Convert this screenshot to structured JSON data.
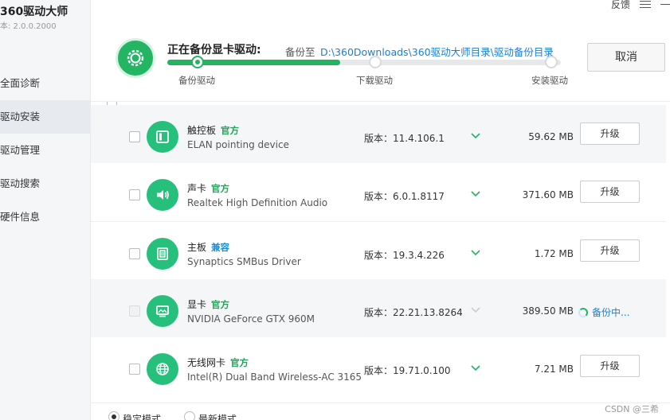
{
  "app": {
    "title": "360驱动大师",
    "version": "本: 2.0.0.2000"
  },
  "topbar": {
    "feedback": "反馈"
  },
  "sidebar": {
    "items": [
      {
        "label": "全面诊断",
        "active": false
      },
      {
        "label": "驱动安装",
        "active": true
      },
      {
        "label": "驱动管理",
        "active": false
      },
      {
        "label": "驱动搜索",
        "active": false
      },
      {
        "label": "硬件信息",
        "active": false
      }
    ]
  },
  "backup": {
    "title": "正在备份显卡驱动:",
    "dest_label": "备份至",
    "path": "D:\\360Downloads\\360驱动大师目录\\驱动备份目录",
    "steps": [
      "备份驱动",
      "下载驱动",
      "安装驱动"
    ],
    "progress": 0.44,
    "cancel_label": "取消"
  },
  "drivers": [
    {
      "name": "触控板",
      "tag": "官方",
      "tag_color": "#23a55a",
      "desc": "ELAN pointing device",
      "version": "版本：11.4.106.1",
      "size": "59.62 MB",
      "action": "升级",
      "icon": "touchpad-icon",
      "status": ""
    },
    {
      "name": "声卡",
      "tag": "官方",
      "tag_color": "#23a55a",
      "desc": "Realtek High Definition Audio",
      "version": "版本：6.0.1.8117",
      "size": "371.60 MB",
      "action": "升级",
      "icon": "speaker-icon",
      "status": ""
    },
    {
      "name": "主板",
      "tag": "兼容",
      "tag_color": "#1a8fd6",
      "desc": "Synaptics SMBus Driver",
      "version": "版本：19.3.4.226",
      "size": "1.72 MB",
      "action": "升级",
      "icon": "motherboard-icon",
      "status": ""
    },
    {
      "name": "显卡",
      "tag": "官方",
      "tag_color": "#23a55a",
      "desc": "NVIDIA GeForce GTX 960M",
      "version": "版本：22.21.13.8264",
      "size": "389.50 MB",
      "action": "",
      "icon": "display-icon",
      "status": "备份中..."
    },
    {
      "name": "无线网卡",
      "tag": "官方",
      "tag_color": "#23a55a",
      "desc": "Intel(R) Dual Band Wireless-AC 3165",
      "version": "版本：19.71.0.100",
      "size": "7.21 MB",
      "action": "升级",
      "icon": "globe-icon",
      "status": ""
    }
  ],
  "bottom": {
    "mode_stable": "稳定模式",
    "mode_latest": "最新模式"
  },
  "watermark": "CSDN @三希",
  "colors": {
    "accent": "#24b363",
    "link": "#1a7fd6"
  }
}
